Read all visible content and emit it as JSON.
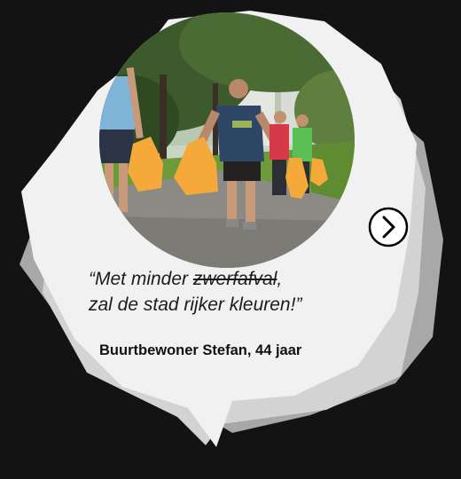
{
  "quote": {
    "open_mark": "“",
    "before": "Met minder ",
    "strike": "zwerfafval",
    "after": ",",
    "line2": "zal de stad rijker kleuren!",
    "close_mark": "”"
  },
  "attribution": "Buurtbewoner Stefan, 44 jaar",
  "icons": {
    "next": "chevron-right-circle-icon"
  },
  "colors": {
    "background": "#131313",
    "bubble_front": "#f1f1f1",
    "bubble_mid": "#d5d5d5",
    "bubble_back": "#b0b0b0",
    "bag": "#f4a93a"
  }
}
